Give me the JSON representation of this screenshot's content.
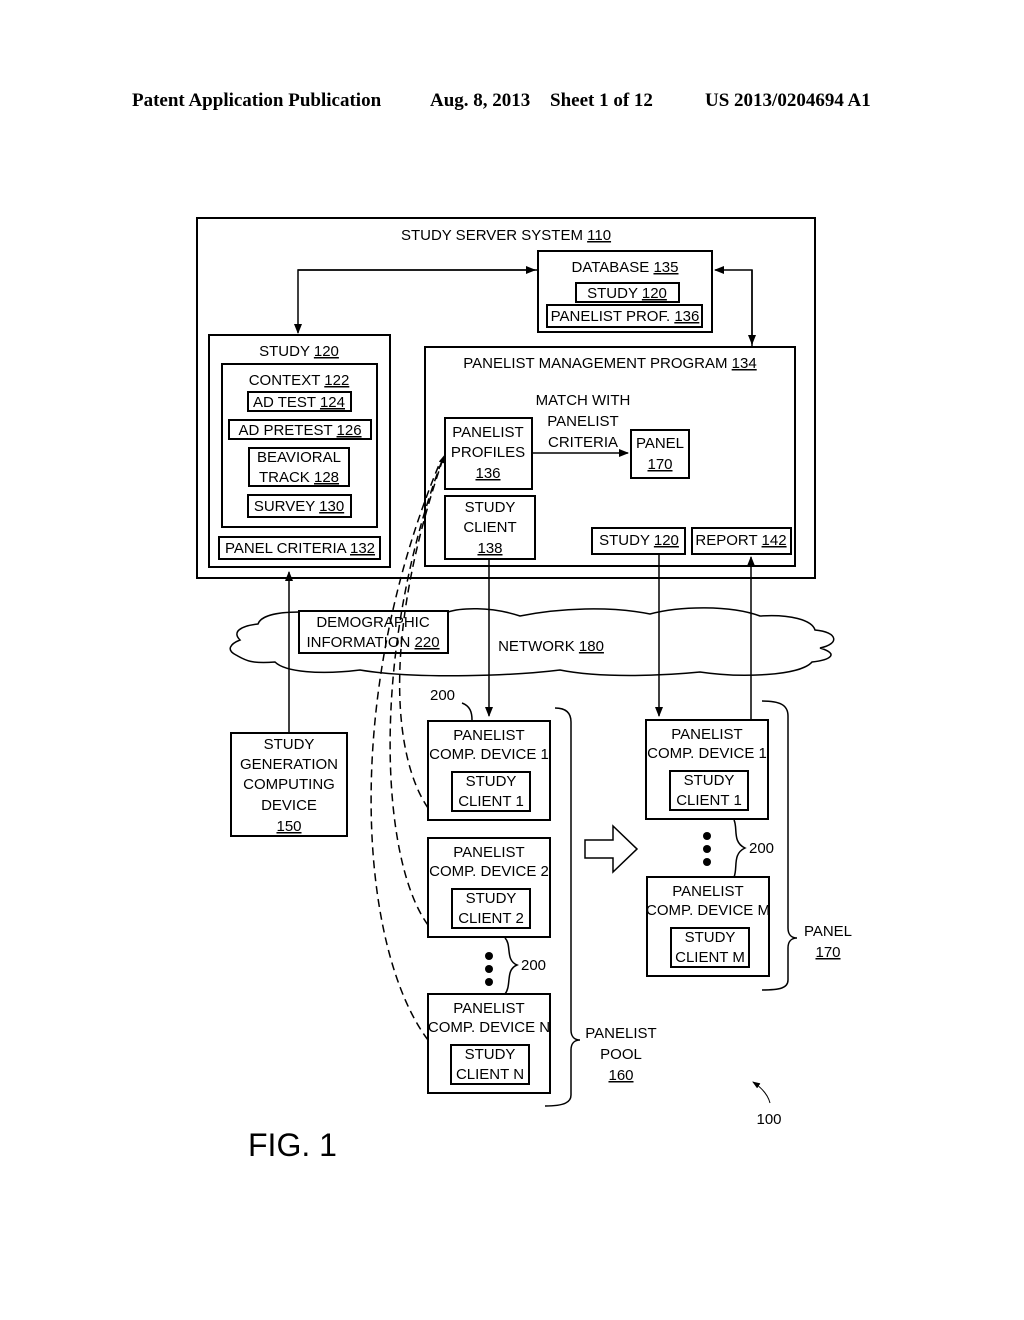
{
  "header": {
    "publication": "Patent Application Publication",
    "date": "Aug. 8, 2013",
    "sheet": "Sheet 1 of 12",
    "number": "US 2013/0204694 A1"
  },
  "server": {
    "label": "STUDY SERVER SYSTEM",
    "ref": "110"
  },
  "database": {
    "label": "DATABASE",
    "ref": "135",
    "study": {
      "label": "STUDY",
      "ref": "120"
    },
    "profiles": {
      "label": "PANELIST PROF.",
      "ref": "136"
    }
  },
  "study": {
    "label": "STUDY",
    "ref": "120",
    "context": {
      "label": "CONTEXT",
      "ref": "122"
    },
    "ad_test": {
      "label": "AD TEST",
      "ref": "124"
    },
    "ad_pretest": {
      "label": "AD PRETEST",
      "ref": "126"
    },
    "behavioral": {
      "line1": "BEAVIORAL",
      "line2": "TRACK",
      "ref": "128"
    },
    "survey": {
      "label": "SURVEY",
      "ref": "130"
    },
    "criteria": {
      "label": "PANEL CRITERIA",
      "ref": "132"
    }
  },
  "pmp": {
    "label": "PANELIST MANAGEMENT PROGRAM",
    "ref": "134",
    "profiles": {
      "line1": "PANELIST",
      "line2": "PROFILES",
      "ref": "136"
    },
    "match": {
      "line1": "MATCH WITH",
      "line2": "PANELIST",
      "line3": "CRITERIA"
    },
    "panel": {
      "label": "PANEL",
      "ref": "170"
    },
    "client": {
      "line1": "STUDY",
      "line2": "CLIENT",
      "ref": "138"
    },
    "study": {
      "label": "STUDY",
      "ref": "120"
    },
    "report": {
      "label": "REPORT",
      "ref": "142"
    }
  },
  "demographic": {
    "line1": "DEMOGRAPHIC",
    "line2": "INFORMATION",
    "ref": "220"
  },
  "network": {
    "label": "NETWORK",
    "ref": "180"
  },
  "generator": {
    "line1": "STUDY",
    "line2": "GENERATION",
    "line3": "COMPUTING",
    "line4": "DEVICE",
    "ref": "150"
  },
  "pool": {
    "line1": "PANELIST",
    "line2": "POOL",
    "ref": "160",
    "device_ref": "200",
    "devices": [
      {
        "line1": "PANELIST",
        "line2": "COMP. DEVICE 1",
        "client1": "STUDY",
        "client2": "CLIENT 1"
      },
      {
        "line1": "PANELIST",
        "line2": "COMP. DEVICE 2",
        "client1": "STUDY",
        "client2": "CLIENT 2"
      },
      {
        "line1": "PANELIST",
        "line2": "COMP. DEVICE N",
        "client1": "STUDY",
        "client2": "CLIENT N"
      }
    ]
  },
  "panel": {
    "line1": "PANEL",
    "ref": "170",
    "device_ref": "200",
    "devices": [
      {
        "line1": "PANELIST",
        "line2": "COMP. DEVICE 1",
        "client1": "STUDY",
        "client2": "CLIENT 1"
      },
      {
        "line1": "PANELIST",
        "line2": "COMP. DEVICE M",
        "client1": "STUDY",
        "client2": "CLIENT M"
      }
    ]
  },
  "system_ref": "100",
  "figure": "FIG. 1"
}
